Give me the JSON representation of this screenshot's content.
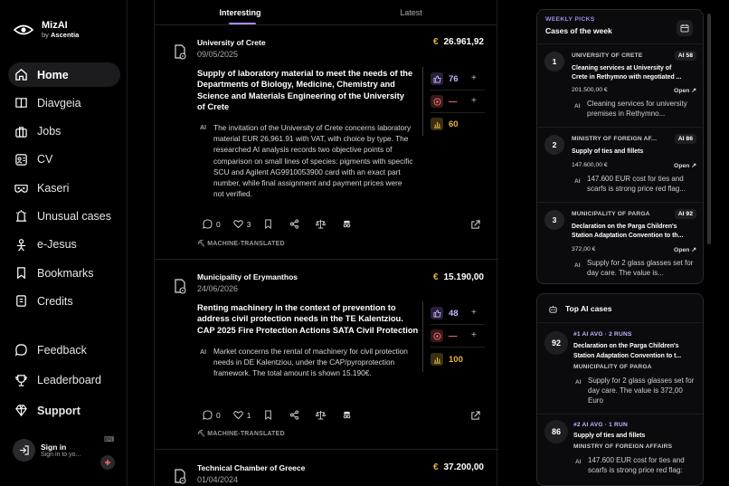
{
  "brand": {
    "name": "MizAI",
    "by_prefix": "by",
    "by_name": "Ascentia"
  },
  "nav": [
    {
      "label": "Home",
      "icon": "home-icon"
    },
    {
      "label": "Diavgeia",
      "icon": "book-icon"
    },
    {
      "label": "Jobs",
      "icon": "briefcase-icon"
    },
    {
      "label": "CV",
      "icon": "id-card-icon"
    },
    {
      "label": "Kaseri",
      "icon": "mask-icon"
    },
    {
      "label": "Unusual cases",
      "icon": "alert-icon"
    },
    {
      "label": "e-Jesus",
      "icon": "person-icon"
    },
    {
      "label": "Bookmarks",
      "icon": "bookmark-icon"
    },
    {
      "label": "Credits",
      "icon": "credits-icon"
    }
  ],
  "nav2": [
    {
      "label": "Feedback",
      "icon": "chat-icon"
    },
    {
      "label": "Leaderboard",
      "icon": "trophy-icon"
    },
    {
      "label": "Support",
      "icon": "gem-icon"
    }
  ],
  "signin": {
    "title": "Sign in",
    "subtitle": "Sign in to yo..."
  },
  "tabs": [
    "Interesting",
    "Latest"
  ],
  "cards": [
    {
      "org": "University of Crete",
      "date": "09/05/2025",
      "amount": "26.961,92",
      "title": "Supply of laboratory material to meet the needs of the Departments of Biology, Medicine, Chemistry and Science and Materials Engineering of the University of Crete",
      "metrics": [
        "76",
        "—",
        "60"
      ],
      "summary": "The invitation of the University of Crete concerns laboratory material EUR 26,961.91 with VAT, with choice by type. The researched AI analysis records two objective points of comparison on small lines of species: pigments with specific SCU and Agilent AG9910053900 card with an exact part number, while final assignment and payment prices were not verified.",
      "comments": "0",
      "likes": "3",
      "tag": "MACHINE-TRANSLATED"
    },
    {
      "org": "Municipality of Erymanthos",
      "date": "24/06/2026",
      "amount": "15.190,00",
      "title": "Renting machinery in the context of prevention to address civil protection needs in the TE Kalentziou. CAP 2025 Fire Protection Actions SATA Civil Protection",
      "metrics": [
        "48",
        "—",
        "100"
      ],
      "summary": "Market concerns the rental of machinery for civil protection needs in DE Kalentziou, under the CAP/pyroprotection framework. The total amount is shown 15.190€.",
      "comments": "0",
      "likes": "1",
      "tag": "MACHINE-TRANSLATED"
    },
    {
      "org": "Technical Chamber of Greece",
      "date": "01/04/2024",
      "amount": "37.200,00"
    }
  ],
  "currency_symbol": "€",
  "ai_label": "AI",
  "weekly": {
    "kicker": "WEEKLY PICKS",
    "title": "Cases of the week",
    "items": [
      {
        "num": "1",
        "org": "UNIVERSITY OF CRETE",
        "ai": "AI 58",
        "title": "Cleaning services at University of Crete in Rethymno with negotiated ...",
        "amount": "201.500,00 €",
        "open": "Open",
        "summary": "Cleaning services for university premises in Rethymno..."
      },
      {
        "num": "2",
        "org": "MINISTRY OF FOREIGN AF...",
        "ai": "AI 86",
        "title": "Supply of ties and fillets",
        "amount": "147.600,00 €",
        "open": "Open",
        "summary": "147.600 EUR cost for ties and scarfs is strong price red flag..."
      },
      {
        "num": "3",
        "org": "MUNICIPALITY OF PARGA",
        "ai": "AI 92",
        "title": "Declaration on the Parga Children's Station Adaptation Convention to th...",
        "amount": "372,00 €",
        "open": "Open",
        "summary": "Supply for 2 glass glasses set for day care. The value is..."
      }
    ]
  },
  "topai": {
    "title": "Top AI cases",
    "items": [
      {
        "score": "92",
        "rank": "#1 AI AVG · 2 RUNS",
        "title": "Declaration on the Parga Children's Station Adaptation Convention to t...",
        "org": "MUNICIPALITY OF PARGA",
        "summary": "Supply for 2 glass glasses set for day care. The value is 372,00 Euro"
      },
      {
        "score": "86",
        "rank": "#2 AI AVG · 1 RUN",
        "title": "Supply of ties and fillets",
        "org": "MINISTRY OF FOREIGN AFFAIRS",
        "summary": "147.600 EUR cost for ties and scarfs is strong price red flag:"
      }
    ]
  },
  "colors": {
    "accent": "#a78bfa",
    "euro": "#e3b341",
    "risk": "#f87171",
    "score": "#e3b341"
  }
}
